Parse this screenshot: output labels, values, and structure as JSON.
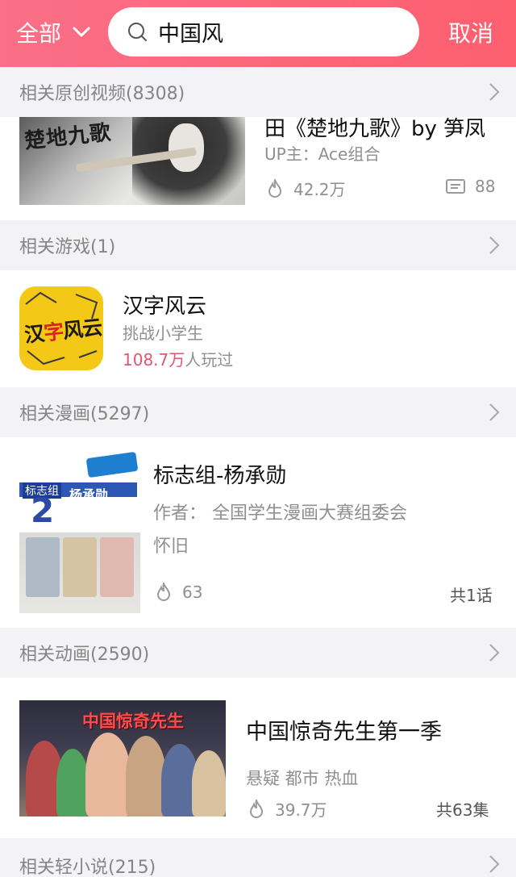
{
  "search": {
    "scope": "全部",
    "query": "中国风",
    "cancel_label": "取消"
  },
  "sections": {
    "videos": {
      "title": "相关原创视频(8308)"
    },
    "games": {
      "title": "相关游戏(1)"
    },
    "comics": {
      "title": "相关漫画(5297)"
    },
    "anime": {
      "title": "相关动画(2590)"
    },
    "novels": {
      "title": "相关轻小说(215)"
    }
  },
  "video": {
    "title": "田《楚地九歌》by 笋凤",
    "uploader": "UP主：Ace组合",
    "plays": "42.2万",
    "comments": "88",
    "thumb_text": "楚地九歌"
  },
  "game": {
    "name": "汉字风云",
    "subtitle": "挑战小学生",
    "players_count": "108.7万",
    "players_suffix": "人玩过",
    "icon_text_1": "汉",
    "icon_text_2": "字",
    "icon_text_3": "风云"
  },
  "comic": {
    "title": "标志组-杨承勋",
    "author": "作者：  全国学生漫画大赛组委会",
    "tag": "怀旧",
    "views": "63",
    "episodes": "共1话",
    "cover_label_group": "标志组",
    "cover_label_num": "2",
    "cover_label_name": "杨承勋"
  },
  "anime": {
    "title": "中国惊奇先生第一季",
    "tags": "悬疑 都市 热血",
    "views": "39.7万",
    "episodes": "共63集",
    "cover_title": "中国惊奇先生"
  },
  "colors": {
    "brand_pink": "#fb6f87",
    "accent_red": "#e2566f",
    "section_bg": "#f3f3f5"
  },
  "icons": [
    "chevron-down-icon",
    "search-icon",
    "chevron-right-icon",
    "flame-icon",
    "comment-icon"
  ]
}
